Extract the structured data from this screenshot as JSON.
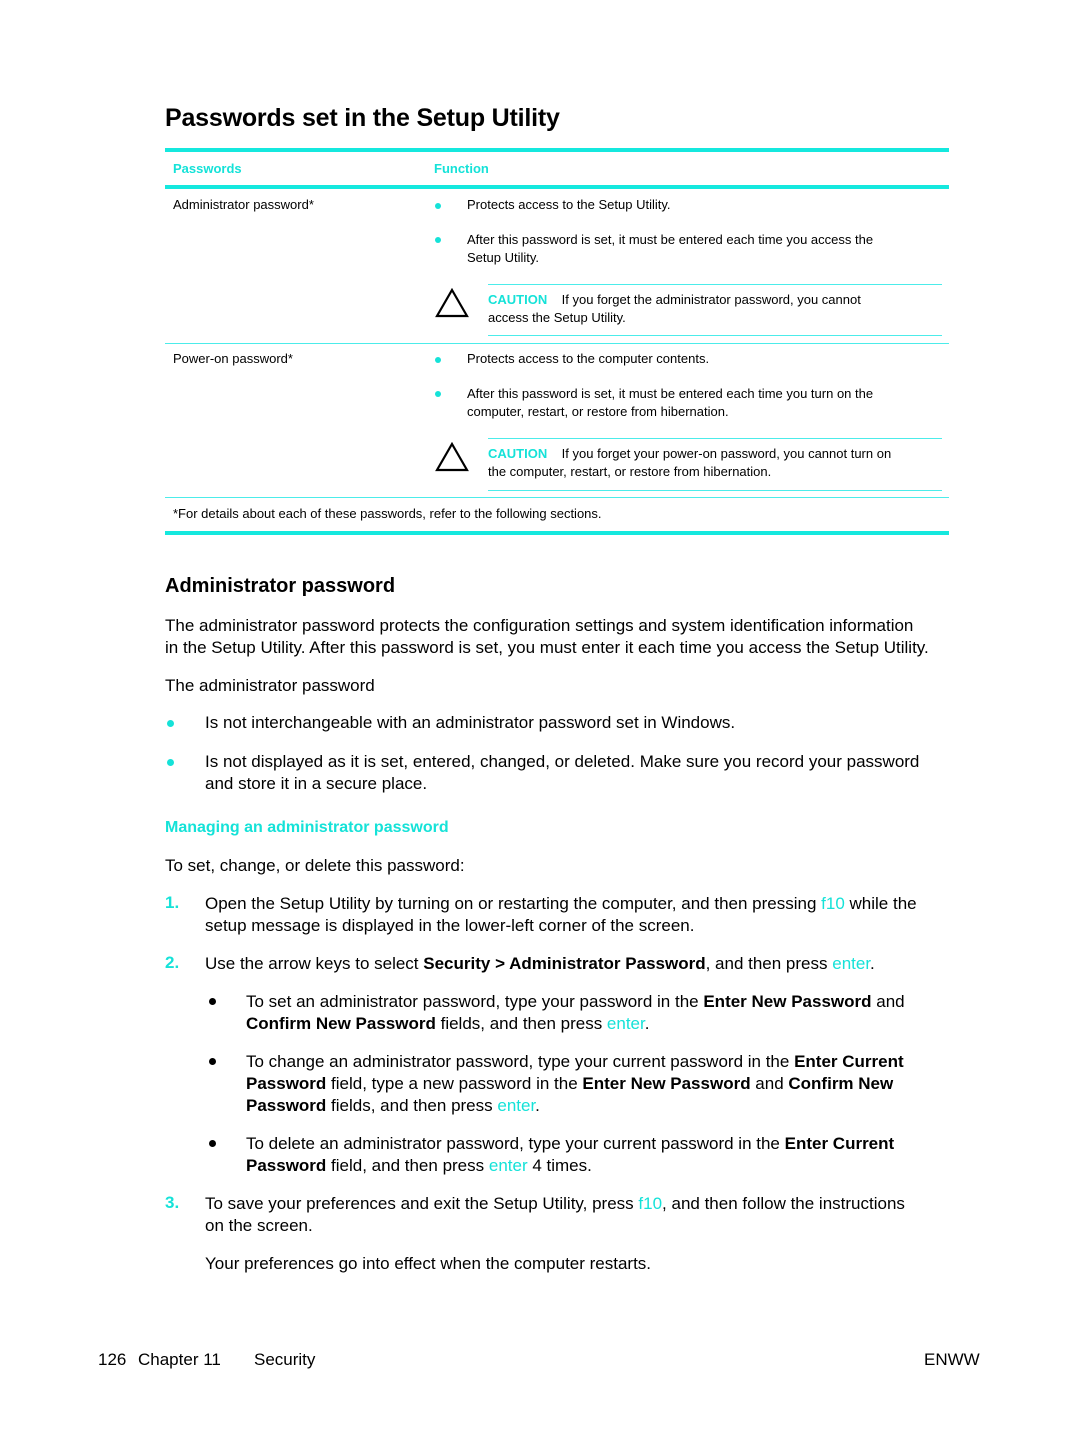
{
  "page_title": "Passwords set in the Setup Utility",
  "table": {
    "headers": [
      "Passwords",
      "Function"
    ],
    "rows": [
      {
        "password": "Administrator password*",
        "bullets": [
          "Protects access to the Setup Utility.",
          "After this password is set, it must be entered each time you access the",
          "Setup Utility."
        ],
        "caution": {
          "label": "CAUTION",
          "line1": "If you forget the administrator password, you cannot",
          "line2": "access the Setup Utility."
        }
      },
      {
        "password": "Power-on password*",
        "bullets": [
          "Protects access to the computer contents.",
          "After this password is set, it must be entered each time you turn on the",
          "computer, restart, or restore from hibernation."
        ],
        "caution": {
          "label": "CAUTION",
          "line1": "If you forget your power-on password, you cannot turn on",
          "line2": "the computer, restart, or restore from hibernation."
        }
      }
    ],
    "footnote": "*For details about each of these passwords, refer to the following sections."
  },
  "section": {
    "title": "Administrator password",
    "intro_line1": "The administrator password protects the configuration settings and system identification information",
    "intro_line2": "in the Setup Utility. After this password is set, you must enter it each time you access the Setup Utility.",
    "lead": "The administrator password",
    "bullets": [
      "Is not interchangeable with an administrator password set in Windows.",
      "Is not displayed as it is set, entered, changed, or deleted. Make sure you record your password",
      "and store it in a secure place."
    ]
  },
  "subsection": {
    "title": "Managing an administrator password",
    "lead": "To set, change, or delete this password:",
    "steps": [
      {
        "number": "1.",
        "l1_a": "Open the Setup Utility by turning on or restarting the computer, and then pressing ",
        "l1_key": "f10",
        "l1_b": " while the",
        "l2": "setup message is displayed in the lower-left corner of the screen."
      },
      {
        "number": "2.",
        "a": "Use the arrow keys to select ",
        "bold": "Security > Administrator Password",
        "b": ", and then press ",
        "key": "enter",
        "c": "."
      },
      {
        "number": "3.",
        "l1_a": "To save your preferences and exit the Setup Utility, press ",
        "l1_key": "f10",
        "l1_b": ", and then follow the instructions",
        "l2": "on the screen.",
        "note": "Your preferences go into effect when the computer restarts."
      }
    ],
    "sub_bullets": [
      {
        "l1_a": "To set an administrator password, type your password in the ",
        "l1_bold": "Enter New Password",
        "l1_b": " and",
        "l2_bold": "Confirm New Password",
        "l2_a": " fields, and then press ",
        "l2_key": "enter",
        "l2_b": "."
      },
      {
        "l1_a": "To change an administrator password, type your current password in the ",
        "l1_bold": "Enter Current",
        "l2_bold1": "Password",
        "l2_a": " field, type a new password in the ",
        "l2_bold2": "Enter New Password",
        "l2_b": " and ",
        "l2_bold3": "Confirm New",
        "l3_bold": "Password",
        "l3_a": " fields, and then press ",
        "l3_key": "enter",
        "l3_b": "."
      },
      {
        "l1_a": "To delete an administrator password, type your current password in the ",
        "l1_bold": "Enter Current",
        "l2_bold": "Password",
        "l2_a": " field, and then press ",
        "l2_key": "enter",
        "l2_b": " 4 times."
      }
    ]
  },
  "footer": {
    "page_number": "126",
    "chapter": "Chapter 11",
    "chapter_title": "Security",
    "locale": "ENWW"
  },
  "colors": {
    "accent": "#15e2d8",
    "rule": "#15e8de"
  }
}
